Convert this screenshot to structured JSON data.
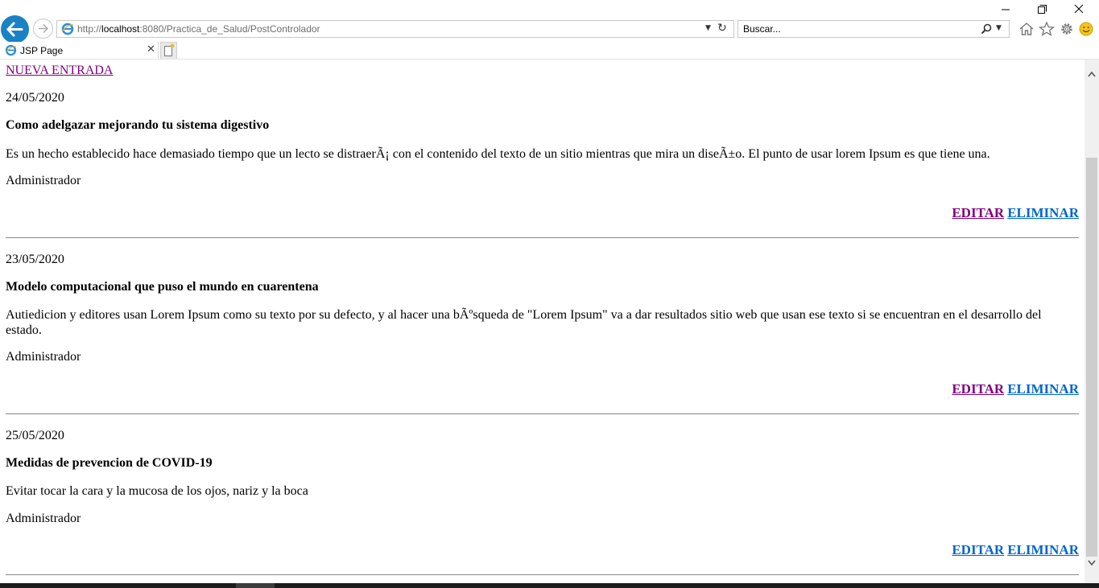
{
  "browser": {
    "url_prefix": "http://",
    "url_host": "localhost",
    "url_rest": ":8080/Practica_de_Salud/PostControlador",
    "search_placeholder": "Buscar...",
    "tab_title": "JSP Page",
    "icons": [
      "back-arrow-icon",
      "forward-arrow-icon",
      "ie-logo-icon",
      "dropdown-icon",
      "refresh-icon",
      "search-icon",
      "home-icon",
      "favorites-star-icon",
      "gear-icon",
      "smiley-icon",
      "close-icon",
      "new-tab-icon",
      "minimize-icon",
      "restore-icon"
    ]
  },
  "page": {
    "new_entry_label": "NUEVA ENTRADA",
    "posts": [
      {
        "date": "24/05/2020",
        "title": "Como adelgazar mejorando tu sistema digestivo",
        "body": "Es un hecho establecido hace demasiado tiempo que un lecto se distraerÃ¡ con el contenido del texto de un sitio mientras que mira un diseÃ±o. El punto de usar lorem Ipsum es que tiene una.",
        "author": "Administrador",
        "edit_label": "EDITAR",
        "delete_label": "ELIMINAR"
      },
      {
        "date": "23/05/2020",
        "title": "Modelo computacional que puso el mundo en cuarentena",
        "body": "Autiedicion y editores usan Lorem Ipsum como su texto por su defecto, y al hacer una bÃºsqueda de \"Lorem Ipsum\" va a dar resultados sitio web que usan ese texto si se encuentran en el desarrollo del estado.",
        "author": "Administrador",
        "edit_label": "EDITAR",
        "delete_label": "ELIMINAR"
      },
      {
        "date": "25/05/2020",
        "title": "Medidas de prevencion de COVID-19",
        "body": "Evitar tocar la cara y la mucosa de los ojos, nariz y la boca",
        "author": "Administrador",
        "edit_label": "EDITAR",
        "delete_label": "ELIMINAR"
      }
    ]
  },
  "colors": {
    "visited_link": "#800080",
    "link": "#0066cc",
    "back_button": "#1a82c4"
  }
}
